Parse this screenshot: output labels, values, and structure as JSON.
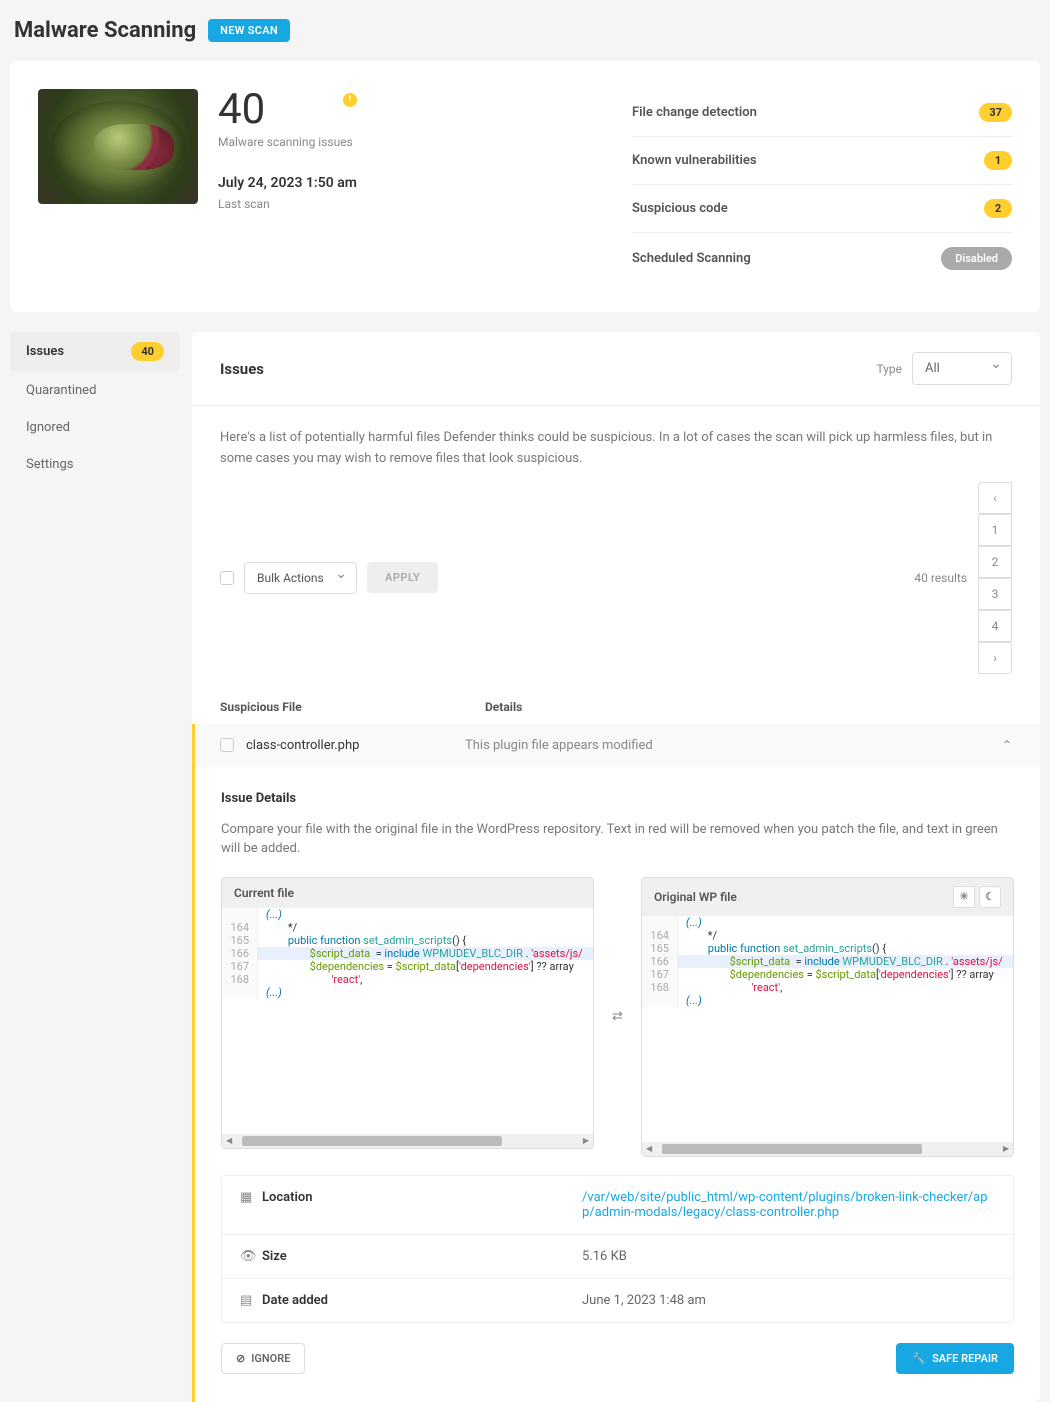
{
  "header": {
    "title": "Malware Scanning",
    "new_scan": "NEW SCAN"
  },
  "summary": {
    "score": "40",
    "score_sub": "Malware scanning issues",
    "time": "July 24, 2023 1:50 am",
    "time_sub": "Last scan",
    "stats": [
      {
        "label": "File change detection",
        "value": "37"
      },
      {
        "label": "Known vulnerabilities",
        "value": "1"
      },
      {
        "label": "Suspicious code",
        "value": "2"
      }
    ],
    "sched_label": "Scheduled Scanning",
    "sched_val": "Disabled"
  },
  "sidebar": {
    "items": [
      {
        "label": "Issues",
        "badge": "40",
        "active": true
      },
      {
        "label": "Quarantined"
      },
      {
        "label": "Ignored"
      },
      {
        "label": "Settings"
      }
    ]
  },
  "content": {
    "heading": "Issues",
    "type_label": "Type",
    "type_value": "All",
    "intro": "Here's a list of potentially harmful files Defender thinks could be suspicious. In a lot of cases the scan will pick up harmless files, but in some cases you may wish to remove files that look suspicious.",
    "bulk_placeholder": "Bulk Actions",
    "apply": "APPLY",
    "results": "40 results",
    "pages": [
      "‹",
      "1",
      "2",
      "3",
      "4",
      "›"
    ],
    "col_file": "Suspicious File",
    "col_detail": "Details",
    "issue": {
      "file": "class-controller.php",
      "detail": "This plugin file appears modified"
    },
    "details": {
      "title": "Issue Details",
      "desc": "Compare your file with the original file in the WordPress repository. Text in red will be removed when you patch the file, and text in green will be added.",
      "cur": "Current file",
      "orig": "Original WP file",
      "code": {
        "fold": "(...)",
        "lines": [
          {
            "n": "164",
            "t": "        */"
          },
          {
            "n": "165",
            "t": "        public function set_admin_scripts() {",
            "hl": false
          },
          {
            "n": "166",
            "t": "                $script_data  = include WPMUDEV_BLC_DIR . 'assets/js/",
            "hl": true
          },
          {
            "n": "167",
            "t": "                $dependencies = $script_data['dependencies'] ?? array"
          },
          {
            "n": "168",
            "t": "                        'react',"
          }
        ]
      },
      "meta": [
        {
          "icon": "folder",
          "k": "Location",
          "v": "/var/web/site/public_html/wp-content/plugins/broken-link-checker/app/admin-modals/legacy/class-controller.php",
          "link": true
        },
        {
          "icon": "eye",
          "k": "Size",
          "v": "5.16 KB"
        },
        {
          "icon": "cal",
          "k": "Date added",
          "v": "June 1, 2023 1:48 am"
        }
      ],
      "ignore": "IGNORE",
      "safe": "SAFE REPAIR"
    }
  }
}
